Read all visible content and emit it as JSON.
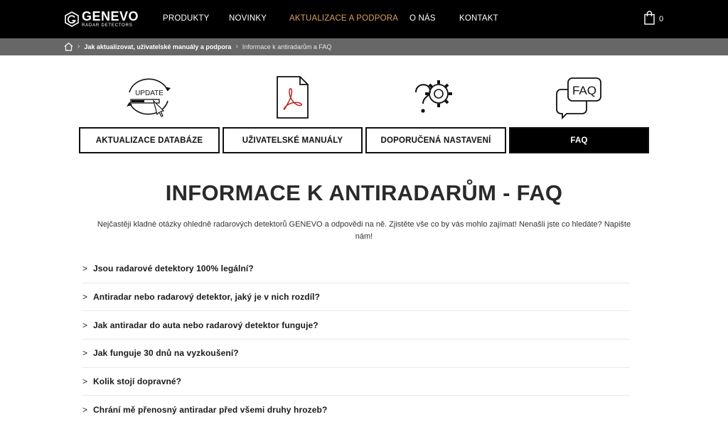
{
  "header": {
    "logo_name": "GENEVO",
    "logo_sub": "RADAR DETECTORS",
    "nav": [
      "PRODUKTY",
      "NOVINKY",
      "AKTUALIZACE A PODPORA",
      "O NÁS",
      "KONTAKT"
    ],
    "active_nav": "AKTUALIZACE A PODPORA",
    "cart_count": "0"
  },
  "breadcrumb": {
    "link": "Jak aktualizovat, uživatelské manuály a podpora",
    "current": "Informace k antiradarům a FAQ"
  },
  "categories": [
    {
      "label": "AKTUALIZACE DATABÁZE",
      "icon": "update-icon",
      "icon_text": "UPDATE"
    },
    {
      "label": "UŽIVATELSKÉ MANUÁLY",
      "icon": "pdf-document-icon"
    },
    {
      "label": "DOPORUČENÁ NASTAVENÍ",
      "icon": "gear-question-icon"
    },
    {
      "label": "FAQ",
      "icon": "faq-speech-bubble-icon",
      "icon_text": "FAQ",
      "active": true
    }
  ],
  "main": {
    "title": "INFORMACE K ANTIRADARŮM - FAQ",
    "intro": "Nejčastěji kladné otázky ohledně radarových detektorů GENEVO a odpovědi na ně. Zjistěte vše co by vás mohlo zajímat! Nenašli jste co hledáte? Napište nám!"
  },
  "faq": {
    "chevron": ">",
    "items": [
      "Jsou radarové detektory 100% legální?",
      "Antiradar nebo radarový detektor, jaký je v nich rozdíl?",
      "Jak antiradar do auta nebo radarový detektor funguje?",
      "Jak funguje 30 dnů na vyzkoušení?",
      "Kolik stojí dopravné?",
      "Chrání mě přenosný antiradar před všemi druhy hrozeb?"
    ]
  },
  "colors": {
    "nav_background": "#000000",
    "active_nav": "#d9a05c",
    "breadcrumb_background": "#676767"
  }
}
